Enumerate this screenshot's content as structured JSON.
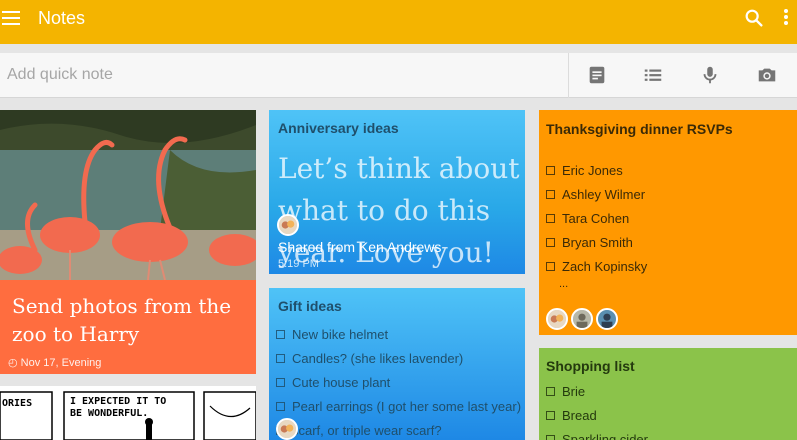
{
  "app": {
    "title": "Notes",
    "icons": {
      "menu": "hamburger-menu-icon",
      "search": "search-icon",
      "more": "overflow-menu-icon"
    },
    "colors": {
      "appbar": "#f4b400"
    }
  },
  "quick_note": {
    "placeholder": "Add quick note",
    "actions": [
      {
        "icon": "note-icon"
      },
      {
        "icon": "list-icon"
      },
      {
        "icon": "microphone-icon"
      },
      {
        "icon": "camera-icon"
      }
    ]
  },
  "cards": {
    "photo_note": {
      "text": "Send photos from the zoo to Harry",
      "reminder": "Nov 17, Evening",
      "color": "#ff6d3f"
    },
    "comic_note": {
      "caption": "I EXPECTED IT TO BE WONDERFUL.",
      "partial_word": "ORIES"
    },
    "anniversary": {
      "title": "Anniversary ideas",
      "body": "Let’s think about what to do this year. Love you!",
      "shared": "Shared from Ken Andrews",
      "time": "5:19 PM",
      "color": "#29a8e8"
    },
    "gift_ideas": {
      "title": "Gift ideas",
      "items": [
        "New bike helmet",
        "Candles? (she likes lavender)",
        "Cute house plant",
        "Pearl earrings (I got her some last year)",
        "scarf, or triple wear scarf?"
      ]
    },
    "thanksgiving": {
      "title": "Thanksgiving dinner RSVPs",
      "items": [
        "Eric Jones",
        "Ashley Wilmer",
        "Tara Cohen",
        "Bryan Smith",
        "Zach Kopinsky"
      ],
      "more": "...",
      "color": "#ff9800"
    },
    "shopping": {
      "title": "Shopping list",
      "items": [
        "Brie",
        "Bread",
        "Sparkling cider"
      ],
      "color": "#8bc34a"
    }
  }
}
